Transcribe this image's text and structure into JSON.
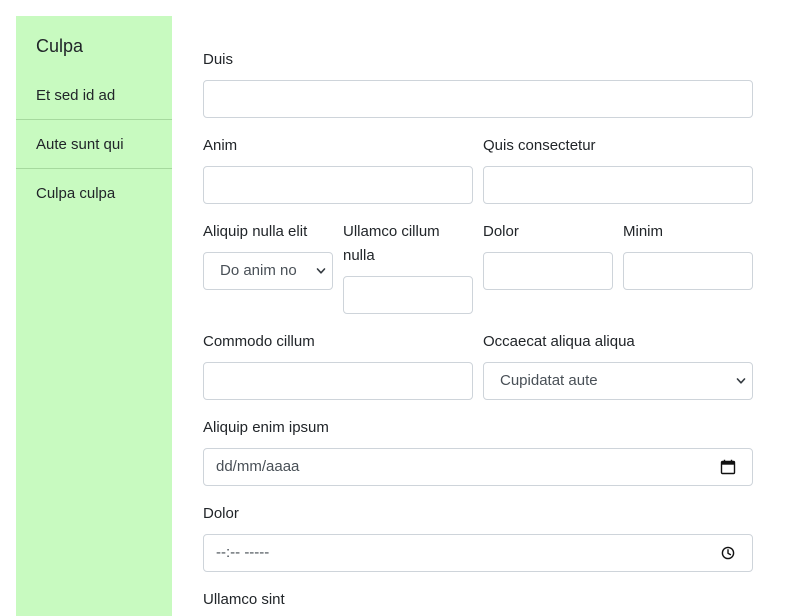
{
  "sidebar": {
    "title": "Culpa",
    "items": [
      {
        "label": "Et sed id ad"
      },
      {
        "label": "Aute sunt qui"
      },
      {
        "label": "Culpa culpa"
      }
    ]
  },
  "form": {
    "duis": {
      "label": "Duis",
      "value": ""
    },
    "anim": {
      "label": "Anim",
      "value": ""
    },
    "quis_consectetur": {
      "label": "Quis consectetur",
      "value": ""
    },
    "aliquip_nulla_elit": {
      "label": "Aliquip nulla elit",
      "selected": "Do anim no"
    },
    "ullamco_cillum_nulla": {
      "label": "Ullamco cillum nulla",
      "value": ""
    },
    "dolor_small": {
      "label": "Dolor",
      "value": ""
    },
    "minim": {
      "label": "Minim",
      "value": ""
    },
    "commodo_cillum": {
      "label": "Commodo cillum",
      "value": ""
    },
    "occaecat_aliqua_aliqua": {
      "label": "Occaecat aliqua aliqua",
      "selected": "Cupidatat aute"
    },
    "aliquip_enim_ipsum": {
      "label": "Aliquip enim ipsum",
      "placeholder": "dd/mm/aaaa"
    },
    "dolor_time": {
      "label": "Dolor",
      "placeholder": "--:-- -----"
    },
    "ullamco_sint": {
      "label": "Ullamco sint"
    }
  },
  "icons": {
    "select_chevron": "chevron-down-icon",
    "date_picker": "calendar-icon",
    "time_picker": "clock-icon"
  },
  "colors": {
    "sidebar_background": "#c8fac0",
    "input_border": "#ced4da",
    "text": "#212529"
  }
}
